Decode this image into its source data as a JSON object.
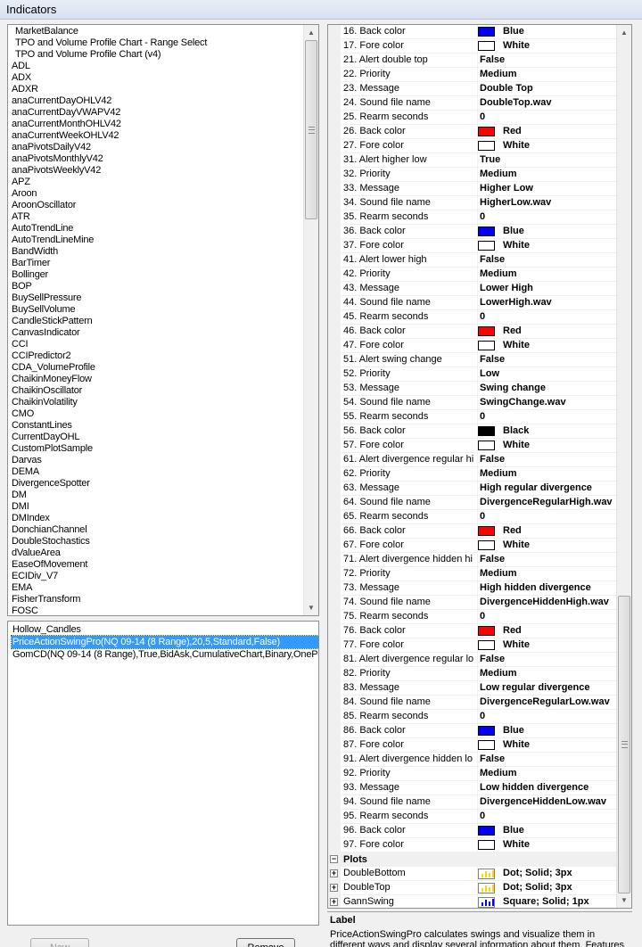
{
  "window": {
    "title": "Indicators"
  },
  "indicator_list": [
    {
      "label": "MarketBalance",
      "indent": true
    },
    {
      "label": "TPO and Volume Profile Chart - Range Select",
      "indent": true
    },
    {
      "label": "TPO and Volume Profile Chart (v4)",
      "indent": true
    },
    {
      "label": "ADL"
    },
    {
      "label": "ADX"
    },
    {
      "label": "ADXR"
    },
    {
      "label": "anaCurrentDayOHLV42"
    },
    {
      "label": "anaCurrentDayVWAPV42"
    },
    {
      "label": "anaCurrentMonthOHLV42"
    },
    {
      "label": "anaCurrentWeekOHLV42"
    },
    {
      "label": "anaPivotsDailyV42"
    },
    {
      "label": "anaPivotsMonthlyV42"
    },
    {
      "label": "anaPivotsWeeklyV42"
    },
    {
      "label": "APZ"
    },
    {
      "label": "Aroon"
    },
    {
      "label": "AroonOscillator"
    },
    {
      "label": "ATR"
    },
    {
      "label": "AutoTrendLine"
    },
    {
      "label": "AutoTrendLineMine"
    },
    {
      "label": "BandWidth"
    },
    {
      "label": "BarTimer"
    },
    {
      "label": "Bollinger"
    },
    {
      "label": "BOP"
    },
    {
      "label": "BuySellPressure"
    },
    {
      "label": "BuySellVolume"
    },
    {
      "label": "CandleStickPattern"
    },
    {
      "label": "CanvasIndicator"
    },
    {
      "label": "CCI"
    },
    {
      "label": "CCIPredictor2"
    },
    {
      "label": "CDA_VolumeProfile"
    },
    {
      "label": "ChaikinMoneyFlow"
    },
    {
      "label": "ChaikinOscillator"
    },
    {
      "label": "ChaikinVolatility"
    },
    {
      "label": "CMO"
    },
    {
      "label": "ConstantLines"
    },
    {
      "label": "CurrentDayOHL"
    },
    {
      "label": "CustomPlotSample"
    },
    {
      "label": "Darvas"
    },
    {
      "label": "DEMA"
    },
    {
      "label": "DivergenceSpotter"
    },
    {
      "label": "DM"
    },
    {
      "label": "DMI"
    },
    {
      "label": "DMIndex"
    },
    {
      "label": "DonchianChannel"
    },
    {
      "label": "DoubleStochastics"
    },
    {
      "label": "dValueArea"
    },
    {
      "label": "EaseOfMovement"
    },
    {
      "label": "ECIDiv_V7"
    },
    {
      "label": "EMA"
    },
    {
      "label": "FisherTransform"
    },
    {
      "label": "FOSC"
    }
  ],
  "applied_list": [
    {
      "label": "Hollow_Candles",
      "selected": false
    },
    {
      "label": "PriceActionSwingPro(NQ 09-14 (8 Range),20,5,Standard,False)",
      "selected": true
    },
    {
      "label": "GomCD(NQ 09-14 (8 Range),True,BidAsk,CumulativeChart,Binary,OnePe",
      "selected": false
    }
  ],
  "buttons": {
    "new": "New",
    "remove": "Remove"
  },
  "properties": [
    {
      "name": "16. Back color",
      "value": "Blue",
      "swatch": "#0000ff"
    },
    {
      "name": "17. Fore color",
      "value": "White",
      "swatch": "#ffffff"
    },
    {
      "name": "21. Alert double top",
      "value": "False"
    },
    {
      "name": "22. Priority",
      "value": "Medium"
    },
    {
      "name": "23. Message",
      "value": "Double Top"
    },
    {
      "name": "24. Sound file name",
      "value": "DoubleTop.wav"
    },
    {
      "name": "25. Rearm seconds",
      "value": "0"
    },
    {
      "name": "26. Back color",
      "value": "Red",
      "swatch": "#ff0000"
    },
    {
      "name": "27. Fore color",
      "value": "White",
      "swatch": "#ffffff"
    },
    {
      "name": "31. Alert higher low",
      "value": "True"
    },
    {
      "name": "32. Priority",
      "value": "Medium"
    },
    {
      "name": "33. Message",
      "value": "Higher Low"
    },
    {
      "name": "34. Sound file name",
      "value": "HigherLow.wav"
    },
    {
      "name": "35. Rearm seconds",
      "value": "0"
    },
    {
      "name": "36. Back color",
      "value": "Blue",
      "swatch": "#0000ff"
    },
    {
      "name": "37. Fore color",
      "value": "White",
      "swatch": "#ffffff"
    },
    {
      "name": "41. Alert lower high",
      "value": "False"
    },
    {
      "name": "42. Priority",
      "value": "Medium"
    },
    {
      "name": "43. Message",
      "value": "Lower High"
    },
    {
      "name": "44. Sound file name",
      "value": "LowerHigh.wav"
    },
    {
      "name": "45. Rearm seconds",
      "value": "0"
    },
    {
      "name": "46. Back color",
      "value": "Red",
      "swatch": "#ff0000"
    },
    {
      "name": "47. Fore color",
      "value": "White",
      "swatch": "#ffffff"
    },
    {
      "name": "51. Alert swing change",
      "value": "False"
    },
    {
      "name": "52. Priority",
      "value": "Low"
    },
    {
      "name": "53. Message",
      "value": "Swing change"
    },
    {
      "name": "54. Sound file name",
      "value": "SwingChange.wav"
    },
    {
      "name": "55. Rearm seconds",
      "value": "0"
    },
    {
      "name": "56. Back color",
      "value": "Black",
      "swatch": "#000000"
    },
    {
      "name": "57. Fore color",
      "value": "White",
      "swatch": "#ffffff"
    },
    {
      "name": "61. Alert divergence regular hi",
      "value": "False"
    },
    {
      "name": "62. Priority",
      "value": "Medium"
    },
    {
      "name": "63. Message",
      "value": "High regular divergence"
    },
    {
      "name": "64. Sound file name",
      "value": "DivergenceRegularHigh.wav"
    },
    {
      "name": "65. Rearm seconds",
      "value": "0"
    },
    {
      "name": "66. Back color",
      "value": "Red",
      "swatch": "#ff0000"
    },
    {
      "name": "67. Fore color",
      "value": "White",
      "swatch": "#ffffff"
    },
    {
      "name": "71. Alert divergence hidden hi",
      "value": "False"
    },
    {
      "name": "72. Priority",
      "value": "Medium"
    },
    {
      "name": "73. Message",
      "value": "High hidden divergence"
    },
    {
      "name": "74. Sound file name",
      "value": "DivergenceHiddenHigh.wav"
    },
    {
      "name": "75. Rearm seconds",
      "value": "0"
    },
    {
      "name": "76. Back color",
      "value": "Red",
      "swatch": "#ff0000"
    },
    {
      "name": "77. Fore color",
      "value": "White",
      "swatch": "#ffffff"
    },
    {
      "name": "81. Alert divergence regular lo",
      "value": "False"
    },
    {
      "name": "82. Priority",
      "value": "Medium"
    },
    {
      "name": "83. Message",
      "value": "Low regular divergence"
    },
    {
      "name": "84. Sound file name",
      "value": "DivergenceRegularLow.wav"
    },
    {
      "name": "85. Rearm seconds",
      "value": "0"
    },
    {
      "name": "86. Back color",
      "value": "Blue",
      "swatch": "#0000ff"
    },
    {
      "name": "87. Fore color",
      "value": "White",
      "swatch": "#ffffff"
    },
    {
      "name": "91. Alert divergence hidden lo",
      "value": "False"
    },
    {
      "name": "92. Priority",
      "value": "Medium"
    },
    {
      "name": "93. Message",
      "value": "Low hidden divergence"
    },
    {
      "name": "94. Sound file name",
      "value": "DivergenceHiddenLow.wav"
    },
    {
      "name": "95. Rearm seconds",
      "value": "0"
    },
    {
      "name": "96. Back color",
      "value": "Blue",
      "swatch": "#0000ff"
    },
    {
      "name": "97. Fore color",
      "value": "White",
      "swatch": "#ffffff"
    }
  ],
  "plots": {
    "category": "Plots",
    "items": [
      {
        "name": "DoubleBottom",
        "value": "Dot; Solid; 3px",
        "color": "#ffd700"
      },
      {
        "name": "DoubleTop",
        "value": "Dot; Solid; 3px",
        "color": "#ffd700"
      },
      {
        "name": "GannSwing",
        "value": "Square; Solid; 1px",
        "color": "#0000ff"
      }
    ]
  },
  "help": {
    "title": "Label",
    "text": "PriceActionSwingPro calculates swings and visualize them in different ways and display several information about them. Features"
  }
}
